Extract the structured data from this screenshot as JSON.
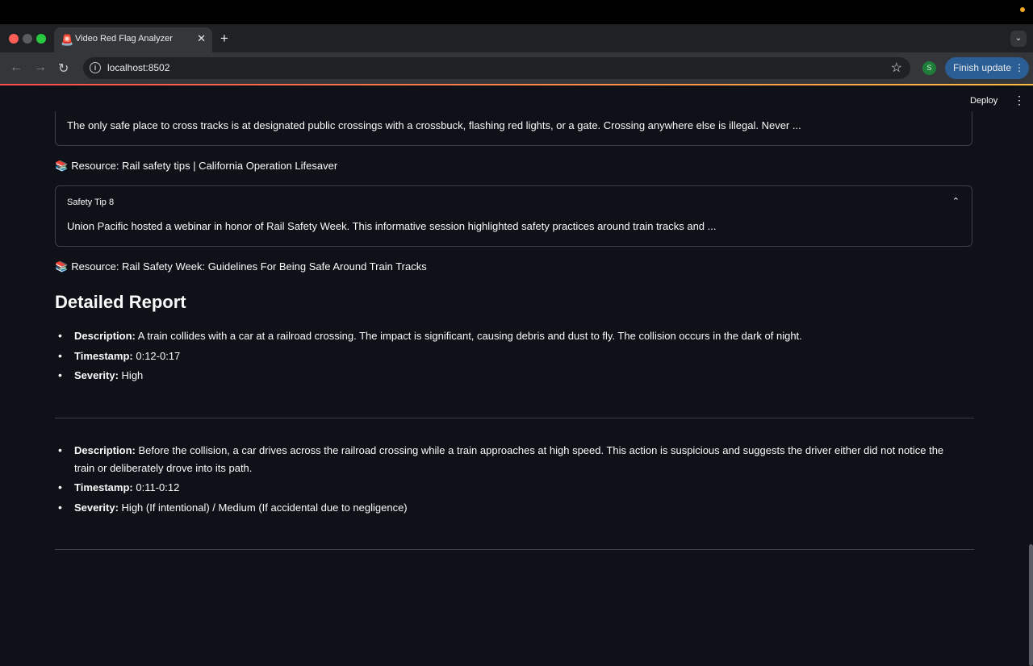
{
  "browser": {
    "tab_title": "Video Red Flag Analyzer",
    "tab_favicon": "siren-icon",
    "url": "localhost:8502",
    "profile_initial": "S",
    "finish_update_label": "Finish update"
  },
  "app": {
    "deploy_label": "Deploy"
  },
  "safety": {
    "tip7_text": "The only safe place to cross tracks is at designated public crossings with a crossbuck, flashing red lights, or a gate. Crossing anywhere else is illegal. Never ...",
    "resource7": "Resource: Rail safety tips | California Operation Lifesaver",
    "tip8_title": "Safety Tip 8",
    "tip8_text": "Union Pacific hosted a webinar in honor of Rail Safety Week. This informative session highlighted safety practices around train tracks and ...",
    "resource8": "Resource: Rail Safety Week: Guidelines For Being Safe Around Train Tracks"
  },
  "report": {
    "heading": "Detailed Report",
    "items": [
      {
        "description_label": "Description:",
        "description": "A train collides with a car at a railroad crossing. The impact is significant, causing debris and dust to fly. The collision occurs in the dark of night.",
        "timestamp_label": "Timestamp:",
        "timestamp": "0:12-0:17",
        "severity_label": "Severity:",
        "severity": "High"
      },
      {
        "description_label": "Description:",
        "description": "Before the collision, a car drives across the railroad crossing while a train approaches at high speed. This action is suspicious and suggests the driver either did not notice the train or deliberately drove into its path.",
        "timestamp_label": "Timestamp:",
        "timestamp": "0:11-0:12",
        "severity_label": "Severity:",
        "severity": "High (If intentional) / Medium (If accidental due to negligence)"
      }
    ]
  }
}
